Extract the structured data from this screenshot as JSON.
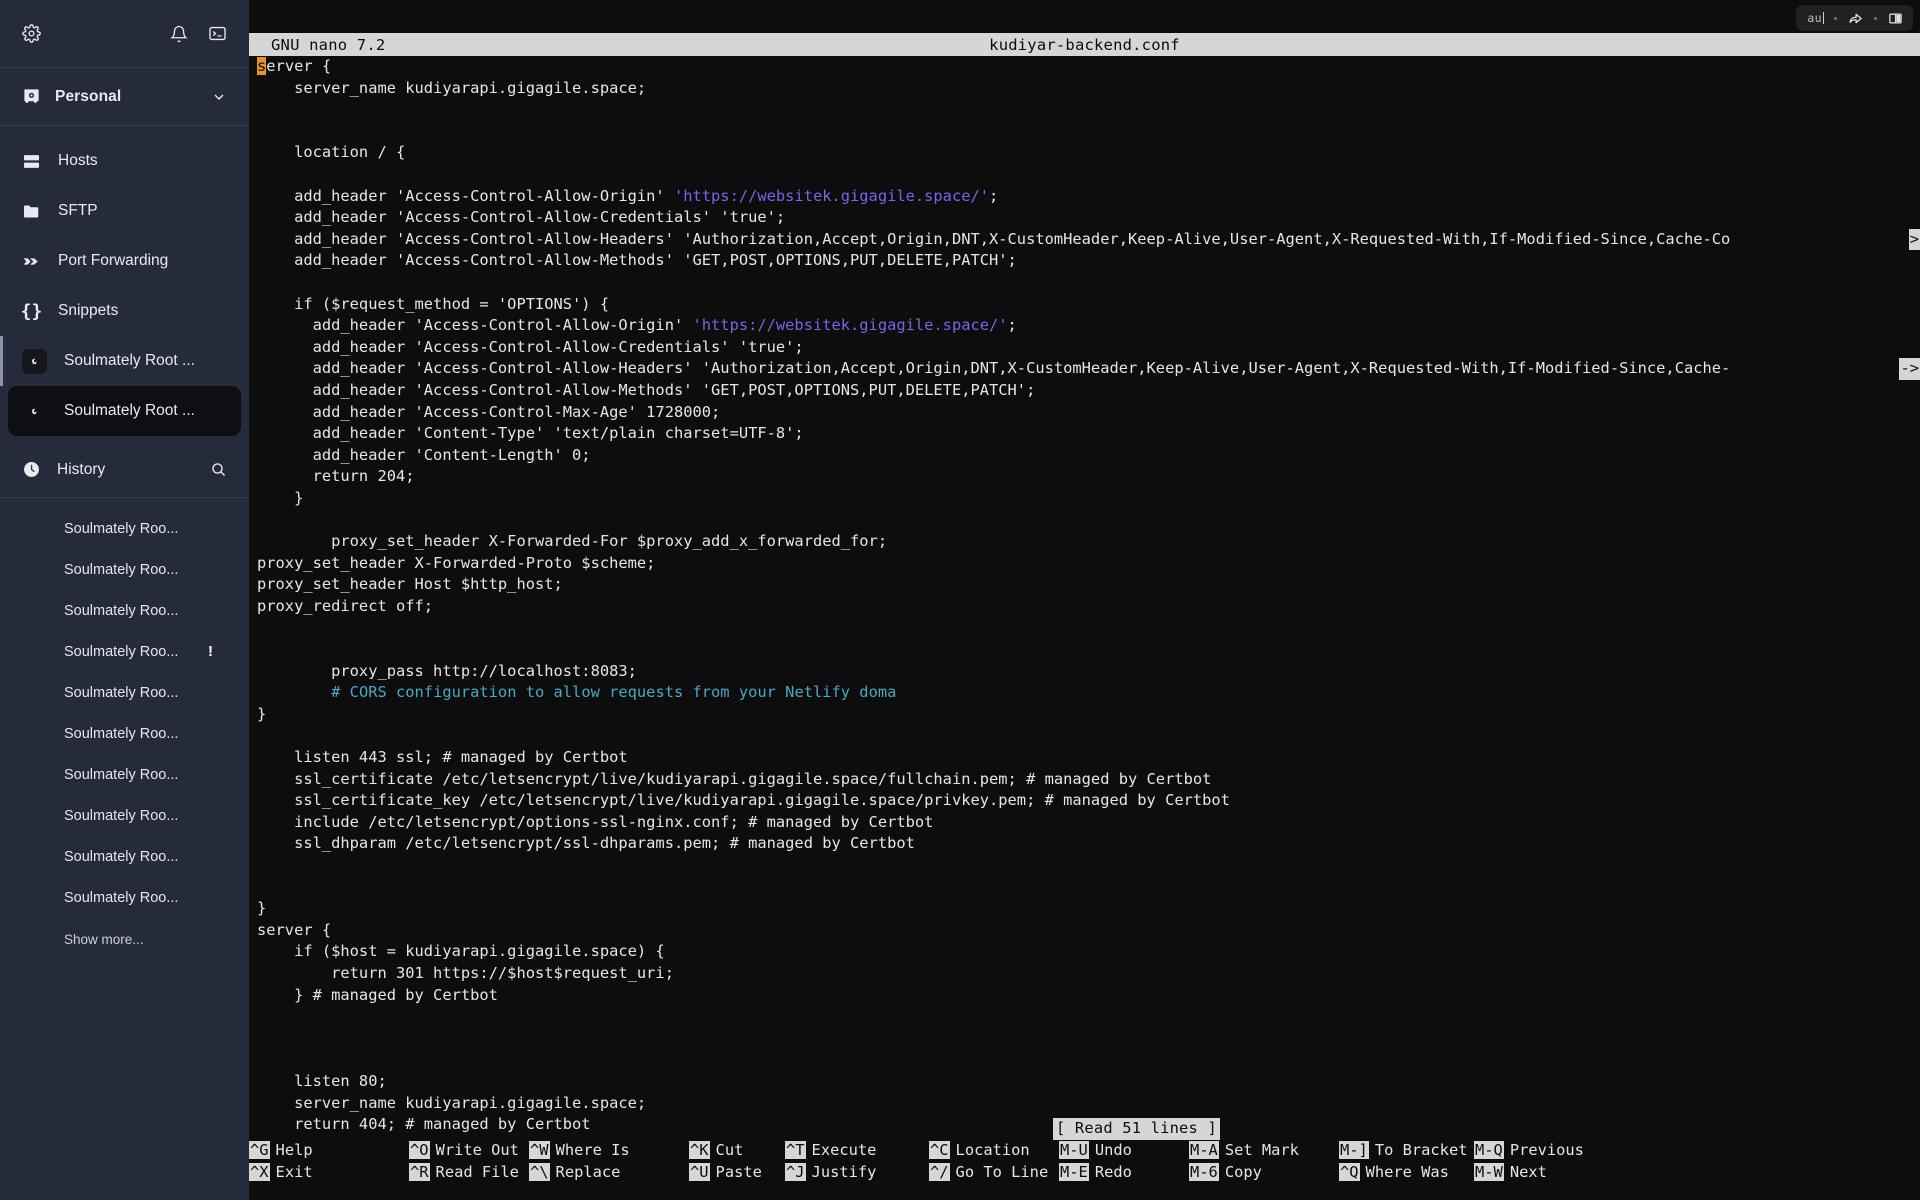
{
  "sidebar": {
    "topbar": {
      "settings_icon": "gear-icon",
      "notifications_icon": "bell-icon",
      "terminal_icon": "terminal-icon"
    },
    "workspace": {
      "icon": "vault-icon",
      "label": "Personal",
      "chevron": "chevron-down-icon"
    },
    "nav_items": [
      {
        "icon": "server-icon",
        "label": "Hosts"
      },
      {
        "icon": "folder-icon",
        "label": "SFTP"
      },
      {
        "icon": "port-forward-icon",
        "label": "Port Forwarding"
      },
      {
        "icon": "braces-icon",
        "label": "Snippets"
      },
      {
        "icon": "debian-icon",
        "label": "Soulmately Root ..."
      },
      {
        "icon": "debian-icon",
        "label": "Soulmately Root ..."
      }
    ],
    "history": {
      "icon": "clock-icon",
      "label": "History",
      "search_icon": "search-icon",
      "items": [
        {
          "label": "Soulmately Roo...",
          "badge": ""
        },
        {
          "label": "Soulmately Roo...",
          "badge": ""
        },
        {
          "label": "Soulmately Roo...",
          "badge": ""
        },
        {
          "label": "Soulmately Roo...",
          "badge": "!"
        },
        {
          "label": "Soulmately Roo...",
          "badge": ""
        },
        {
          "label": "Soulmately Roo...",
          "badge": ""
        },
        {
          "label": "Soulmately Roo...",
          "badge": ""
        },
        {
          "label": "Soulmately Roo...",
          "badge": ""
        },
        {
          "label": "Soulmately Roo...",
          "badge": ""
        },
        {
          "label": "Soulmately Roo...",
          "badge": ""
        }
      ],
      "show_more": "Show more..."
    }
  },
  "window_controls": {
    "search_value": "au",
    "share_icon": "share-arrow-icon",
    "split_icon": "split-pane-icon"
  },
  "editor": {
    "version": "GNU nano 7.2",
    "filename": "kudiyar-backend.conf",
    "status_message": "[ Read 51 lines ]",
    "cursor_char": "s",
    "colors": {
      "title_bar_bg": "#d6d6d6",
      "terminal_bg": "#0d0d0d",
      "cursor": "#e8922a",
      "url": "#7b63e8",
      "comment": "#49a8c4"
    },
    "lines": [
      {
        "segs": [
          {
            "t": "s",
            "c": "cur"
          },
          {
            "t": "erver {"
          }
        ]
      },
      {
        "segs": [
          {
            "t": "    server_name kudiyarapi.gigagile.space;"
          }
        ]
      },
      {
        "segs": [
          {
            "t": ""
          }
        ]
      },
      {
        "segs": [
          {
            "t": ""
          }
        ]
      },
      {
        "segs": [
          {
            "t": "    location / {"
          }
        ]
      },
      {
        "segs": [
          {
            "t": ""
          }
        ]
      },
      {
        "segs": [
          {
            "t": "    add_header 'Access-Control-Allow-Origin' "
          },
          {
            "t": "'https://websitek.gigagile.space/'",
            "c": "url"
          },
          {
            "t": ";"
          }
        ]
      },
      {
        "segs": [
          {
            "t": "    add_header 'Access-Control-Allow-Credentials' 'true';"
          }
        ]
      },
      {
        "segs": [
          {
            "t": "    add_header 'Access-Control-Allow-Headers' 'Authorization,Accept,Origin,DNT,X-CustomHeader,Keep-Alive,User-Agent,X-Requested-With,If-Modified-Since,Cache-Co"
          }
        ],
        "wrap": ">"
      },
      {
        "segs": [
          {
            "t": "    add_header 'Access-Control-Allow-Methods' 'GET,POST,OPTIONS,PUT,DELETE,PATCH';"
          }
        ]
      },
      {
        "segs": [
          {
            "t": ""
          }
        ]
      },
      {
        "segs": [
          {
            "t": "    if ($request_method = 'OPTIONS') {"
          }
        ]
      },
      {
        "segs": [
          {
            "t": "      add_header 'Access-Control-Allow-Origin' "
          },
          {
            "t": "'https://websitek.gigagile.space/'",
            "c": "url"
          },
          {
            "t": ";"
          }
        ]
      },
      {
        "segs": [
          {
            "t": "      add_header 'Access-Control-Allow-Credentials' 'true';"
          }
        ]
      },
      {
        "segs": [
          {
            "t": "      add_header 'Access-Control-Allow-Headers' 'Authorization,Accept,Origin,DNT,X-CustomHeader,Keep-Alive,User-Agent,X-Requested-With,If-Modified-Since,Cache-"
          }
        ],
        "wrap": "->"
      },
      {
        "segs": [
          {
            "t": "      add_header 'Access-Control-Allow-Methods' 'GET,POST,OPTIONS,PUT,DELETE,PATCH';"
          }
        ]
      },
      {
        "segs": [
          {
            "t": "      add_header 'Access-Control-Max-Age' 1728000;"
          }
        ]
      },
      {
        "segs": [
          {
            "t": "      add_header 'Content-Type' 'text/plain charset=UTF-8';"
          }
        ]
      },
      {
        "segs": [
          {
            "t": "      add_header 'Content-Length' 0;"
          }
        ]
      },
      {
        "segs": [
          {
            "t": "      return 204;"
          }
        ]
      },
      {
        "segs": [
          {
            "t": "    }"
          }
        ]
      },
      {
        "segs": [
          {
            "t": ""
          }
        ]
      },
      {
        "segs": [
          {
            "t": "        proxy_set_header X-Forwarded-For $proxy_add_x_forwarded_for;"
          }
        ]
      },
      {
        "segs": [
          {
            "t": "proxy_set_header X-Forwarded-Proto $scheme;"
          }
        ]
      },
      {
        "segs": [
          {
            "t": "proxy_set_header Host $http_host;"
          }
        ]
      },
      {
        "segs": [
          {
            "t": "proxy_redirect off;"
          }
        ]
      },
      {
        "segs": [
          {
            "t": ""
          }
        ]
      },
      {
        "segs": [
          {
            "t": ""
          }
        ]
      },
      {
        "segs": [
          {
            "t": "        proxy_pass http://localhost:8083;"
          }
        ]
      },
      {
        "segs": [
          {
            "t": "        "
          },
          {
            "t": "# CORS configuration to allow requests from your Netlify doma",
            "c": "cmt"
          }
        ]
      },
      {
        "segs": [
          {
            "t": "}"
          }
        ]
      },
      {
        "segs": [
          {
            "t": ""
          }
        ]
      },
      {
        "segs": [
          {
            "t": "    listen 443 ssl; # managed by Certbot"
          }
        ]
      },
      {
        "segs": [
          {
            "t": "    ssl_certificate /etc/letsencrypt/live/kudiyarapi.gigagile.space/fullchain.pem; # managed by Certbot"
          }
        ]
      },
      {
        "segs": [
          {
            "t": "    ssl_certificate_key /etc/letsencrypt/live/kudiyarapi.gigagile.space/privkey.pem; # managed by Certbot"
          }
        ]
      },
      {
        "segs": [
          {
            "t": "    include /etc/letsencrypt/options-ssl-nginx.conf; # managed by Certbot"
          }
        ]
      },
      {
        "segs": [
          {
            "t": "    ssl_dhparam /etc/letsencrypt/ssl-dhparams.pem; # managed by Certbot"
          }
        ]
      },
      {
        "segs": [
          {
            "t": ""
          }
        ]
      },
      {
        "segs": [
          {
            "t": ""
          }
        ]
      },
      {
        "segs": [
          {
            "t": "}"
          }
        ]
      },
      {
        "segs": [
          {
            "t": "server {"
          }
        ]
      },
      {
        "segs": [
          {
            "t": "    if ($host = kudiyarapi.gigagile.space) {"
          }
        ]
      },
      {
        "segs": [
          {
            "t": "        return 301 https://$host$request_uri;"
          }
        ]
      },
      {
        "segs": [
          {
            "t": "    } # managed by Certbot"
          }
        ]
      },
      {
        "segs": [
          {
            "t": ""
          }
        ]
      },
      {
        "segs": [
          {
            "t": ""
          }
        ]
      },
      {
        "segs": [
          {
            "t": ""
          }
        ]
      },
      {
        "segs": [
          {
            "t": "    listen 80;"
          }
        ]
      },
      {
        "segs": [
          {
            "t": "    server_name kudiyarapi.gigagile.space;"
          }
        ]
      },
      {
        "segs": [
          {
            "t": "    return 404; # managed by Certbot"
          }
        ]
      }
    ],
    "shortcuts_row1": [
      {
        "key": "^G",
        "label": "Help"
      },
      {
        "key": "^O",
        "label": "Write Out"
      },
      {
        "key": "^W",
        "label": "Where Is"
      },
      {
        "key": "^K",
        "label": "Cut"
      },
      {
        "key": "^T",
        "label": "Execute"
      },
      {
        "key": "^C",
        "label": "Location"
      },
      {
        "key": "M-U",
        "label": "Undo"
      },
      {
        "key": "M-A",
        "label": "Set Mark"
      },
      {
        "key": "M-]",
        "label": "To Bracket"
      },
      {
        "key": "M-Q",
        "label": "Previous"
      }
    ],
    "shortcuts_row2": [
      {
        "key": "^X",
        "label": "Exit"
      },
      {
        "key": "^R",
        "label": "Read File"
      },
      {
        "key": "^\\",
        "label": "Replace"
      },
      {
        "key": "^U",
        "label": "Paste"
      },
      {
        "key": "^J",
        "label": "Justify"
      },
      {
        "key": "^/",
        "label": "Go To Line"
      },
      {
        "key": "M-E",
        "label": "Redo"
      },
      {
        "key": "M-6",
        "label": "Copy"
      },
      {
        "key": "^Q",
        "label": "Where Was"
      },
      {
        "key": "M-W",
        "label": "Next"
      }
    ]
  }
}
